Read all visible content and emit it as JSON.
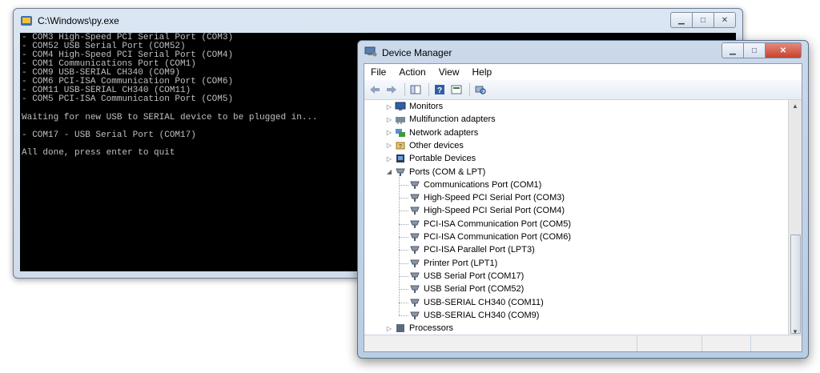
{
  "console": {
    "title": "C:\\Windows\\py.exe",
    "lines": [
      "- COM3 High-Speed PCI Serial Port (COM3)",
      "- COM52 USB Serial Port (COM52)",
      "- COM4 High-Speed PCI Serial Port (COM4)",
      "- COM1 Communications Port (COM1)",
      "- COM9 USB-SERIAL CH340 (COM9)",
      "- COM6 PCI-ISA Communication Port (COM6)",
      "- COM11 USB-SERIAL CH340 (COM11)",
      "- COM5 PCI-ISA Communication Port (COM5)"
    ],
    "waiting": "Waiting for new USB to SERIAL device to be plugged in...",
    "found": "- COM17 - USB Serial Port (COM17)",
    "done": "All done, press enter to quit"
  },
  "device_manager": {
    "title": "Device Manager",
    "menu": [
      "File",
      "Action",
      "View",
      "Help"
    ],
    "tree": [
      {
        "label": "Monitors",
        "icon": "monitor-icon",
        "expanded": false
      },
      {
        "label": "Multifunction adapters",
        "icon": "adapter-icon",
        "expanded": false
      },
      {
        "label": "Network adapters",
        "icon": "network-icon",
        "expanded": false
      },
      {
        "label": "Other devices",
        "icon": "unknown-device-icon",
        "expanded": false
      },
      {
        "label": "Portable Devices",
        "icon": "portable-device-icon",
        "expanded": false
      },
      {
        "label": "Ports (COM & LPT)",
        "icon": "port-icon",
        "expanded": true
      }
    ],
    "ports": [
      "Communications Port (COM1)",
      "High-Speed PCI Serial Port (COM3)",
      "High-Speed PCI Serial Port (COM4)",
      "PCI-ISA Communication Port (COM5)",
      "PCI-ISA Communication Port (COM6)",
      "PCI-ISA Parallel Port (LPT3)",
      "Printer Port (LPT1)",
      "USB Serial Port (COM17)",
      "USB Serial Port (COM52)",
      "USB-SERIAL CH340 (COM11)",
      "USB-SERIAL CH340 (COM9)"
    ],
    "partial_next": "Processors"
  }
}
